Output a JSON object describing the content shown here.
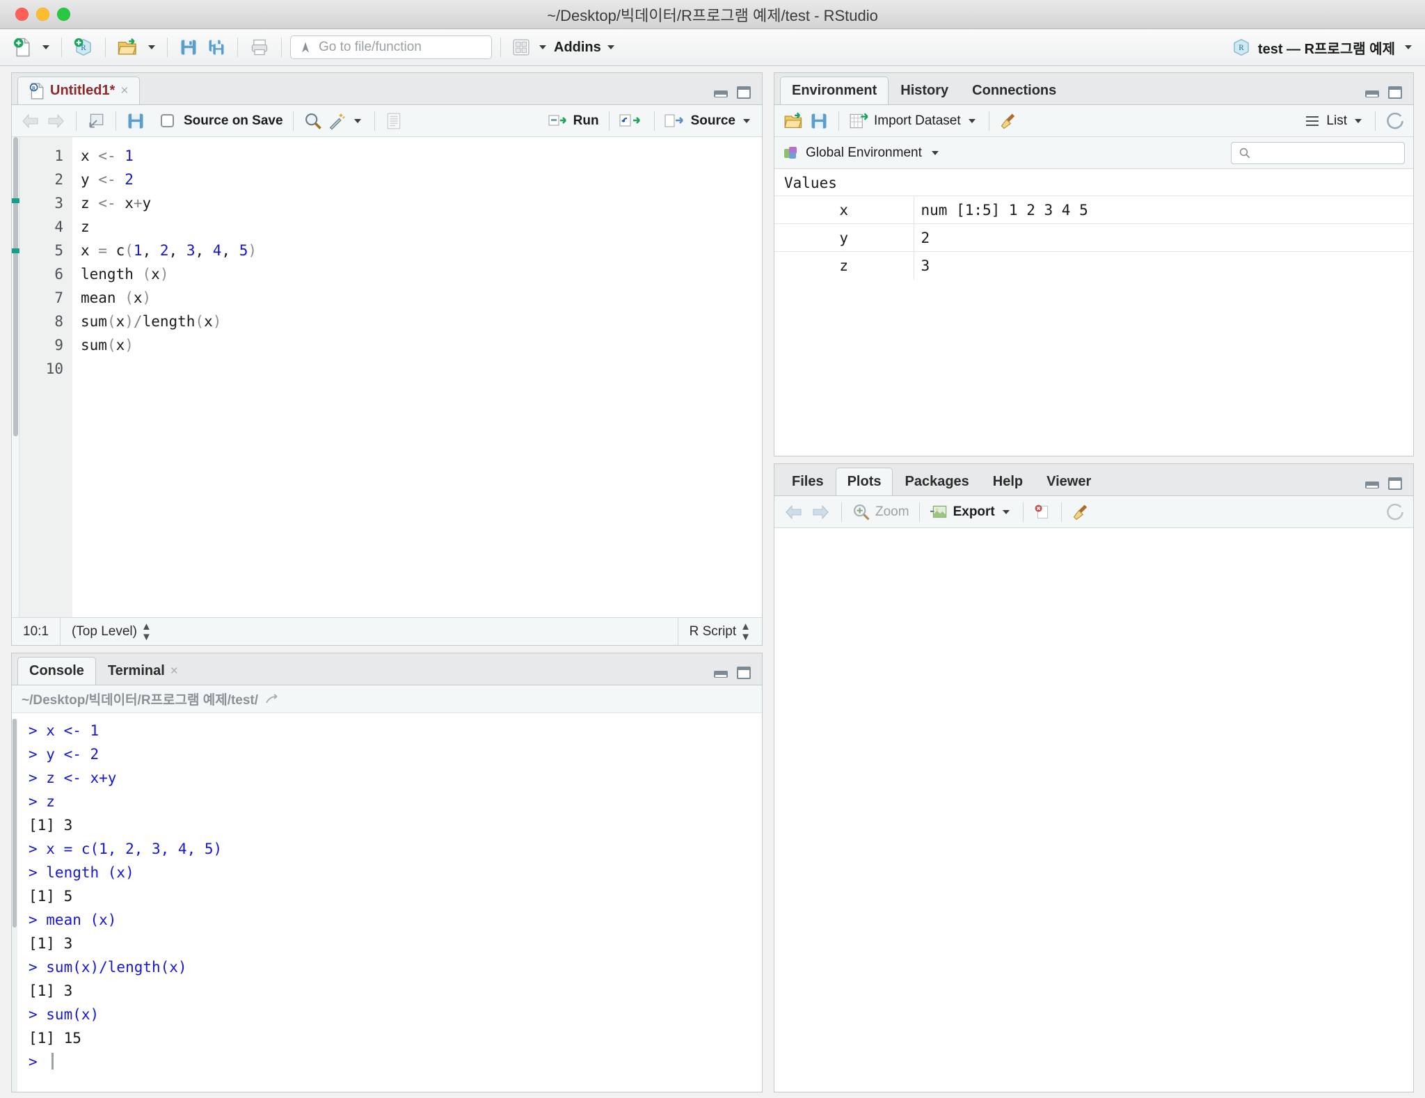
{
  "window": {
    "title": "~/Desktop/빅데이터/R프로그램 예제/test - RStudio",
    "traffic_lights": [
      "close",
      "minimize",
      "zoom"
    ]
  },
  "toolbar": {
    "new_file": "new-file",
    "new_project": "new-project",
    "open_file": "open-file",
    "save": "save",
    "save_all": "save-all",
    "print": "print",
    "goto_placeholder": "Go to file/function",
    "panes_icon": "panes-grid",
    "addins_label": "Addins",
    "project_label": "test — R프로그램 예제"
  },
  "editor": {
    "tab_label": "Untitled1*",
    "tab_close": "×",
    "source_on_save": "Source on Save",
    "run_label": "Run",
    "source_label": "Source",
    "lines": [
      {
        "n": "1",
        "code": "x <- 1"
      },
      {
        "n": "2",
        "code": "y <- 2"
      },
      {
        "n": "3",
        "code": "z <- x+y"
      },
      {
        "n": "4",
        "code": "z"
      },
      {
        "n": "5",
        "code": "x = c(1, 2, 3, 4, 5)"
      },
      {
        "n": "6",
        "code": "length (x)"
      },
      {
        "n": "7",
        "code": "mean (x)"
      },
      {
        "n": "8",
        "code": "sum(x)/length(x)"
      },
      {
        "n": "9",
        "code": "sum(x)"
      },
      {
        "n": "10",
        "code": ""
      }
    ],
    "status": {
      "position": "10:1",
      "scope": "(Top Level)",
      "filetype": "R Script"
    }
  },
  "console": {
    "tabs": [
      {
        "label": "Console",
        "active": true,
        "closable": false
      },
      {
        "label": "Terminal",
        "active": false,
        "closable": true
      }
    ],
    "path": "~/Desktop/빅데이터/R프로그램 예제/test/",
    "lines": [
      {
        "kind": "in",
        "text": "> x <- 1"
      },
      {
        "kind": "in",
        "text": "> y <- 2"
      },
      {
        "kind": "in",
        "text": "> z <- x+y"
      },
      {
        "kind": "in",
        "text": "> z"
      },
      {
        "kind": "out",
        "text": "[1] 3"
      },
      {
        "kind": "in",
        "text": "> x = c(1, 2, 3, 4, 5)"
      },
      {
        "kind": "in",
        "text": "> length (x)"
      },
      {
        "kind": "out",
        "text": "[1] 5"
      },
      {
        "kind": "in",
        "text": "> mean (x)"
      },
      {
        "kind": "out",
        "text": "[1] 3"
      },
      {
        "kind": "in",
        "text": "> sum(x)/length(x)"
      },
      {
        "kind": "out",
        "text": "[1] 3"
      },
      {
        "kind": "in",
        "text": "> sum(x)"
      },
      {
        "kind": "out",
        "text": "[1] 15"
      },
      {
        "kind": "in",
        "text": "> "
      }
    ]
  },
  "environment": {
    "tabs": [
      {
        "label": "Environment",
        "active": true
      },
      {
        "label": "History",
        "active": false
      },
      {
        "label": "Connections",
        "active": false
      }
    ],
    "import_dataset": "Import Dataset",
    "view_mode": "List",
    "scope_label": "Global Environment",
    "search_value": "",
    "section_title": "Values",
    "rows": [
      {
        "name": "x",
        "value": "num [1:5] 1 2 3 4 5"
      },
      {
        "name": "y",
        "value": "2"
      },
      {
        "name": "z",
        "value": "3"
      }
    ]
  },
  "plots": {
    "tabs": [
      {
        "label": "Files",
        "active": false
      },
      {
        "label": "Plots",
        "active": true
      },
      {
        "label": "Packages",
        "active": false
      },
      {
        "label": "Help",
        "active": false
      },
      {
        "label": "Viewer",
        "active": false
      }
    ],
    "zoom_label": "Zoom",
    "export_label": "Export"
  },
  "colors": {
    "accent_blue": "#1414dd",
    "tab_red": "#8d2a2a",
    "pane_bg": "#ffffff",
    "chrome": "#f4f7f8",
    "border": "#c3c8cb",
    "light_red": "#ff5f57",
    "light_yellow": "#febc2e",
    "light_green": "#28c840"
  }
}
